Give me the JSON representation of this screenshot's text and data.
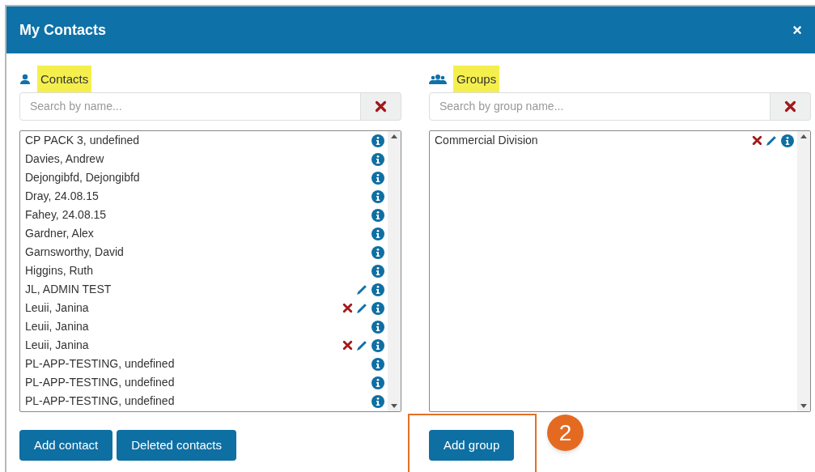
{
  "window": {
    "title": "My Contacts",
    "close": "×"
  },
  "contacts": {
    "heading": "Contacts",
    "highlighted": true,
    "search": {
      "placeholder": "Search by name..."
    },
    "rows": [
      {
        "name": "CP PACK 3, undefined",
        "delete": false,
        "edit": false
      },
      {
        "name": "Davies, Andrew",
        "delete": false,
        "edit": false
      },
      {
        "name": "Dejongibfd, Dejongibfd",
        "delete": false,
        "edit": false
      },
      {
        "name": "Dray, 24.08.15",
        "delete": false,
        "edit": false
      },
      {
        "name": "Fahey, 24.08.15",
        "delete": false,
        "edit": false
      },
      {
        "name": "Gardner, Alex",
        "delete": false,
        "edit": false
      },
      {
        "name": "Garnsworthy, David",
        "delete": false,
        "edit": false
      },
      {
        "name": "Higgins, Ruth",
        "delete": false,
        "edit": false
      },
      {
        "name": "JL, ADMIN TEST",
        "delete": false,
        "edit": true
      },
      {
        "name": "Leuii, Janina",
        "delete": true,
        "edit": true
      },
      {
        "name": "Leuii, Janina",
        "delete": false,
        "edit": false
      },
      {
        "name": "Leuii, Janina",
        "delete": true,
        "edit": true
      },
      {
        "name": "PL-APP-TESTING, undefined",
        "delete": false,
        "edit": false
      },
      {
        "name": "PL-APP-TESTING, undefined",
        "delete": false,
        "edit": false
      },
      {
        "name": "PL-APP-TESTING, undefined",
        "delete": false,
        "edit": false
      }
    ],
    "buttons": [
      "Add contact",
      "Deleted contacts"
    ]
  },
  "groups": {
    "heading": "Groups",
    "highlighted": true,
    "search": {
      "placeholder": "Search by group name..."
    },
    "rows": [
      {
        "name": "Commercial Division",
        "delete": true,
        "edit": true
      }
    ],
    "buttons": [
      "Add group"
    ]
  },
  "annotation": {
    "callout": "2"
  }
}
